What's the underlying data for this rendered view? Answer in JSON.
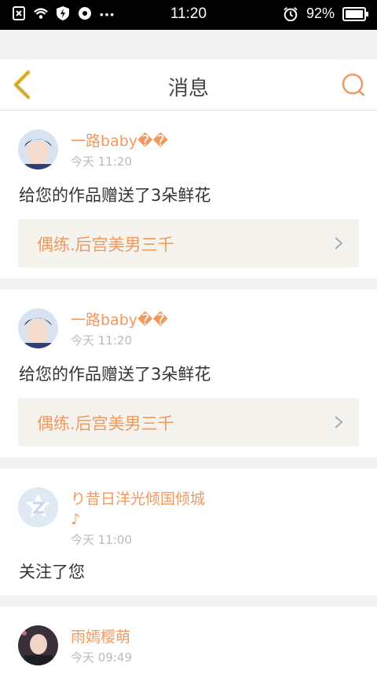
{
  "status": {
    "time": "11:20",
    "battery": "92%"
  },
  "nav": {
    "title": "消息"
  },
  "messages": [
    {
      "user": "一路baby��",
      "time": "今天 11:20",
      "text": "给您的作品赠送了3朵鲜花",
      "work": "偶练.后宫美男三千"
    },
    {
      "user": "一路baby��",
      "time": "今天 11:20",
      "text": "给您的作品赠送了3朵鲜花",
      "work": "偶练.后宫美男三千"
    },
    {
      "user": "り昔日洋光倾国倾城",
      "user_line2": "♪",
      "time": "今天 11:00",
      "text": "关注了您"
    },
    {
      "user": "雨嫣樱萌",
      "time": "今天 09:49"
    }
  ],
  "colors": {
    "accent": "#f0995f",
    "back": "#e6c13a",
    "bg": "#f2f2f2"
  },
  "icons": [
    "back-chevron-icon",
    "search-icon",
    "chevron-right-icon"
  ]
}
